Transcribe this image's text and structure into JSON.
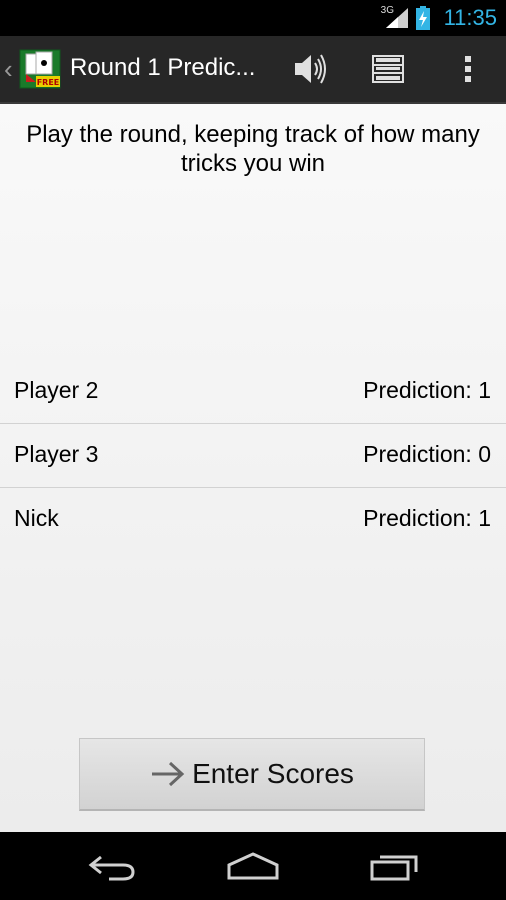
{
  "status_bar": {
    "network": "3G",
    "time": "11:35"
  },
  "action_bar": {
    "title": "Round 1 Predic...",
    "icon_label": "FREE"
  },
  "instructions": "Play the round, keeping track of how many tricks you win",
  "players": [
    {
      "name": "Player 2",
      "prediction": "Prediction: 1"
    },
    {
      "name": "Player 3",
      "prediction": "Prediction: 0"
    },
    {
      "name": "Nick",
      "prediction": "Prediction: 1"
    }
  ],
  "enter_button": {
    "label": "Enter Scores"
  },
  "colors": {
    "accent": "#33b5e5",
    "action_bar_bg": "#272727"
  },
  "icons": {
    "sound": "speaker-icon",
    "list": "list-icon",
    "overflow": "overflow-menu-icon",
    "arrow": "arrow-right-icon",
    "nav_back": "back-icon",
    "nav_home": "home-icon",
    "nav_recent": "recent-apps-icon"
  }
}
